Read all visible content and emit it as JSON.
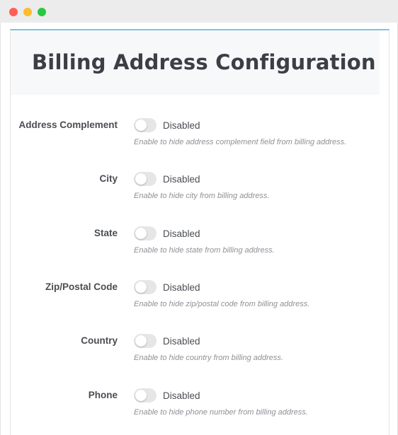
{
  "page_title": "Billing Address Configuration",
  "fields": [
    {
      "label": "Address Complement",
      "state": "Disabled",
      "enabled": false,
      "help": "Enable to hide address complement field from billing address."
    },
    {
      "label": "City",
      "state": "Disabled",
      "enabled": false,
      "help": "Enable to hide city from billing address."
    },
    {
      "label": "State",
      "state": "Disabled",
      "enabled": false,
      "help": "Enable to hide state from billing address."
    },
    {
      "label": "Zip/Postal Code",
      "state": "Disabled",
      "enabled": false,
      "help": "Enable to hide zip/postal code from billing address."
    },
    {
      "label": "Country",
      "state": "Disabled",
      "enabled": false,
      "help": "Enable to hide country from billing address."
    },
    {
      "label": "Phone",
      "state": "Disabled",
      "enabled": false,
      "help": "Enable to hide phone number from billing address."
    }
  ],
  "colors": {
    "accent_border": "#7fc4d8",
    "toggle_off": "#e6e6e6",
    "title_text": "#3b3f45"
  }
}
